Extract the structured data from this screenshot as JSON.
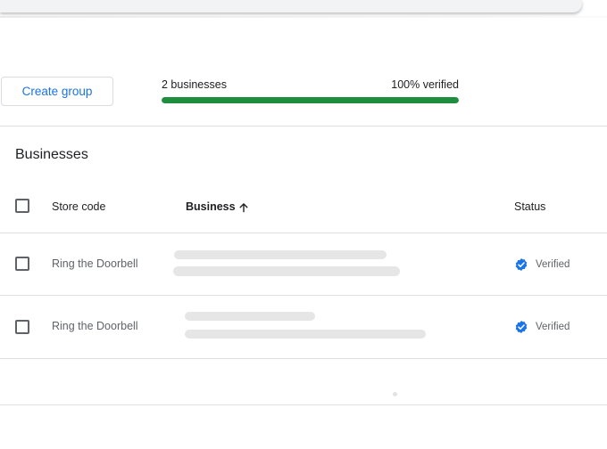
{
  "toolbar": {
    "create_group_label": "Create group"
  },
  "summary": {
    "count_label": "2 businesses",
    "verified_label": "100% verified",
    "verified_fraction": 1.0,
    "bar_color": "#1e8e3e"
  },
  "section": {
    "title": "Businesses"
  },
  "table": {
    "headers": {
      "store_code": "Store code",
      "business": "Business",
      "status": "Status"
    },
    "sort_icon": "arrow-up-icon",
    "rows": [
      {
        "store_code": "Ring the Doorbell",
        "status": "Verified",
        "status_icon": "verified-check-icon"
      },
      {
        "store_code": "Ring the Doorbell",
        "status": "Verified",
        "status_icon": "verified-check-icon"
      }
    ]
  },
  "colors": {
    "accent": "#1a73e8",
    "verified_badge": "#1a73e8"
  }
}
